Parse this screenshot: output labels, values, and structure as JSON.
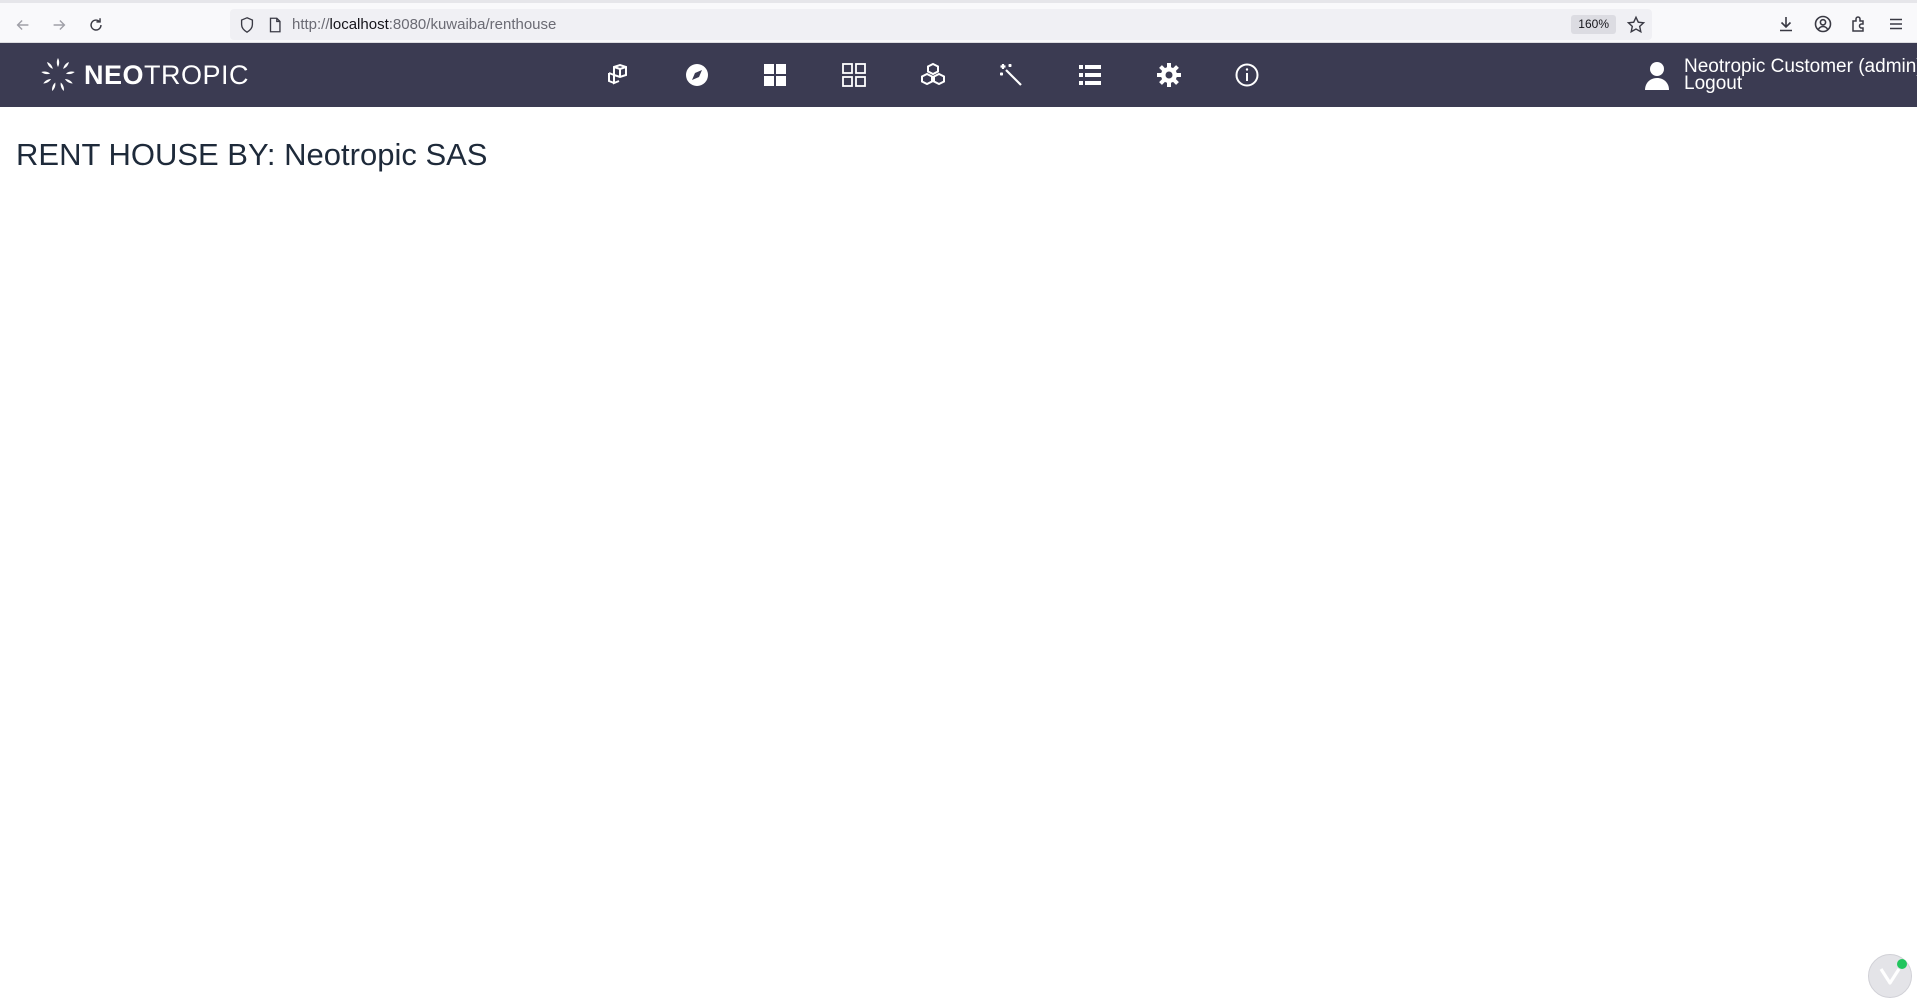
{
  "browser": {
    "url_scheme": "http://",
    "url_host": "localhost",
    "url_path": ":8080/kuwaiba/renthouse",
    "zoom": "160%",
    "icons": [
      "back-arrow-icon",
      "forward-arrow-icon",
      "reload-icon",
      "shield-icon",
      "page-icon",
      "star-icon",
      "download-icon",
      "account-icon",
      "extensions-icon",
      "hamburger-menu-icon"
    ]
  },
  "header": {
    "logo_bold": "NEO",
    "logo_light": "TROPIC",
    "menu_icons": [
      "cube-stack-icon",
      "compass-icon",
      "dashboard-grid-icon",
      "grid-outline-icon",
      "cubes-icon",
      "magic-wand-icon",
      "list-icon",
      "gear-icon",
      "info-icon"
    ],
    "user": {
      "name": "Neotropic Customer (admin)",
      "logout": "Logout"
    },
    "background": "#3b3b52"
  },
  "main": {
    "title": "RENT HOUSE BY: Neotropic SAS"
  },
  "colors": {
    "status_dot": "#22c55e"
  }
}
